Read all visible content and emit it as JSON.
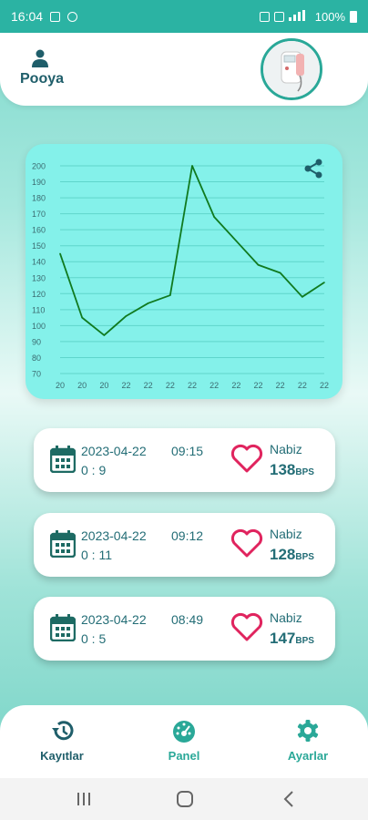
{
  "status_bar": {
    "time": "16:04",
    "battery": "100%"
  },
  "header": {
    "user_name": "Pooya"
  },
  "chart_data": {
    "type": "line",
    "x": [
      "20",
      "20",
      "20",
      "22",
      "22",
      "22",
      "22",
      "22",
      "22",
      "22",
      "22",
      "22",
      "22"
    ],
    "values": [
      145,
      105,
      94,
      106,
      114,
      119,
      200,
      168,
      153,
      138,
      133,
      118,
      127
    ],
    "ylim": [
      70,
      200
    ],
    "yticks": [
      200,
      190,
      180,
      170,
      160,
      150,
      140,
      130,
      120,
      110,
      100,
      90,
      80,
      70
    ],
    "grid": true,
    "line_color": "#107a1f"
  },
  "records": [
    {
      "date": "2023-04-22",
      "time": "09:15",
      "duration": "0 : 9",
      "label": "Nabiz",
      "bpm": "138",
      "unit": "BPS"
    },
    {
      "date": "2023-04-22",
      "time": "09:12",
      "duration": "0 : 11",
      "label": "Nabiz",
      "bpm": "128",
      "unit": "BPS"
    },
    {
      "date": "2023-04-22",
      "time": "08:49",
      "duration": "0 : 5",
      "label": "Nabiz",
      "bpm": "147",
      "unit": "BPS"
    }
  ],
  "bottom_nav": [
    {
      "label": "Kayıtlar",
      "color": "#1f5e6a",
      "icon": "history-icon"
    },
    {
      "label": "Panel",
      "color": "#2aa898",
      "icon": "dashboard-icon"
    },
    {
      "label": "Ayarlar",
      "color": "#2aa898",
      "icon": "gear-icon"
    }
  ],
  "colors": {
    "accent": "#2aa898",
    "status_bar": "#2bb3a3",
    "heart": "#e0245e",
    "chart_bg": "#84f1ea"
  }
}
